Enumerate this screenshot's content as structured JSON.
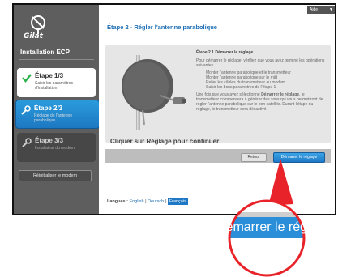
{
  "app": {
    "brand": "Gilat",
    "title": "Installation ECP"
  },
  "sidebar": {
    "steps": [
      {
        "title": "Étape 1/3",
        "subtitle": "Saisir les paramètres d'installation",
        "state": "done",
        "icon": "checkmark-icon"
      },
      {
        "title": "Étape 2/3",
        "subtitle": "Réglage de l'antenne parabolique",
        "state": "active",
        "icon": "wrench-icon"
      },
      {
        "title": "Étape 3/3",
        "subtitle": "Installation du modem",
        "state": "pending",
        "icon": "wrench-icon"
      }
    ],
    "reset_label": "Réinitialiser le modem"
  },
  "header": {
    "language_select": "Aide"
  },
  "main": {
    "page_title": "Étape 2 - Régler l'antenne parabolique",
    "section_title": "Étape 2.1 Démarrer le réglage",
    "intro": "Pour démarrer le réglage, vérifiez que vous avez terminé les opérations suivantes.",
    "checklist": [
      "Monter l'antenne parabolique et le transmetteur",
      "Monter l'antenne parabolique sur le mât",
      "Relier les câbles du transmetteur au modem",
      "Saisir les bons paramètres de l'étape 1"
    ],
    "description_before": "Une fois que vous avez sélectionné ",
    "description_bold": "Démarrer le réglage",
    "description_after": ", le transmetteur commencera à générer des sons qui vous permettront de régler l'antenne parabolique sur le bon satellite. Durant l'étape du réglage, le transmetteur sera désactivé.",
    "call_to_action": "Cliquer sur Réglage pour continuer",
    "back_label": "Retour",
    "start_label": "Démarrer le réglage"
  },
  "footer": {
    "languages_label": "Langues :",
    "languages": [
      "English",
      "Deutsch",
      "Français"
    ],
    "active_language": "Français"
  },
  "zoom_callout": {
    "text": "Démarrer le régla"
  },
  "colors": {
    "accent_blue": "#1f78c6",
    "sidebar_gray": "#5e5e5e",
    "callout_red": "#e8232a"
  }
}
